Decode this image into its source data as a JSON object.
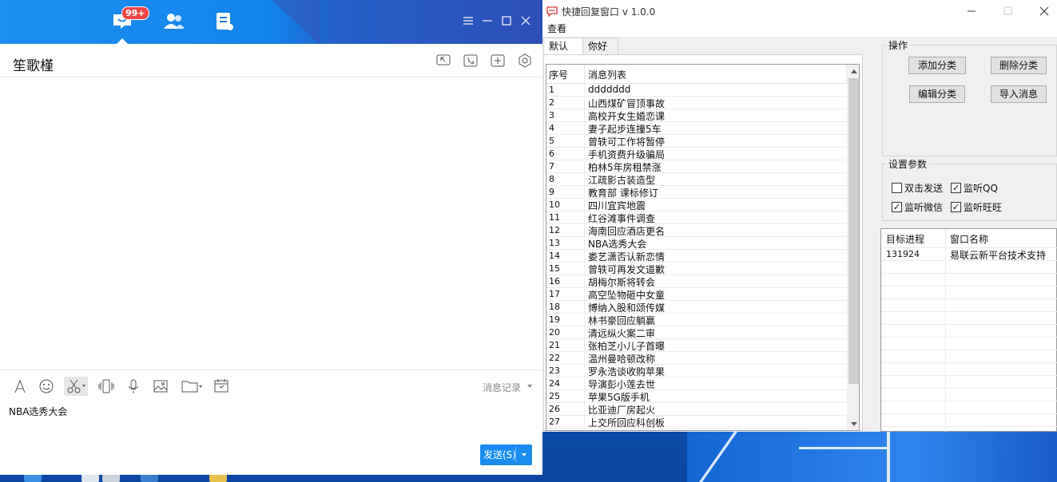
{
  "qq": {
    "badge": "99+",
    "contact_name": "笙歌槿",
    "history_label": "消息记录",
    "input_text": "NBA选秀大会",
    "send_label": "发送(S)"
  },
  "quick_reply": {
    "title": "快捷回复窗口 v 1.0.0",
    "menu_view": "查看",
    "tabs": [
      "默认",
      "你好"
    ],
    "list_headers": [
      "序号",
      "消息列表"
    ],
    "rows": [
      [
        "1",
        "ddddddd"
      ],
      [
        "2",
        "山西煤矿冒顶事故"
      ],
      [
        "3",
        "高校开女生婚恋课"
      ],
      [
        "4",
        "妻子起步连撞5车"
      ],
      [
        "5",
        "曾轶可工作将暂停"
      ],
      [
        "6",
        "手机资费升级骗局"
      ],
      [
        "7",
        "柏林5年房租禁涨"
      ],
      [
        "8",
        "江疏影古装造型"
      ],
      [
        "9",
        "教育部 课标修订"
      ],
      [
        "10",
        "四川宜宾地震"
      ],
      [
        "11",
        "红谷滩事件调查"
      ],
      [
        "12",
        "海南回应酒店更名"
      ],
      [
        "13",
        "NBA选秀大会"
      ],
      [
        "14",
        "娄艺潇否认新恋情"
      ],
      [
        "15",
        "曾轶可再发文道歉"
      ],
      [
        "16",
        "胡梅尔斯将转会"
      ],
      [
        "17",
        "高空坠物砸中女童"
      ],
      [
        "18",
        "博纳入股和颂传媒"
      ],
      [
        "19",
        "林书豪回应躺赢"
      ],
      [
        "20",
        "清远纵火案二审"
      ],
      [
        "21",
        "张柏芝小儿子首曝"
      ],
      [
        "22",
        "温州曼哈顿改称"
      ],
      [
        "23",
        "罗永浩谈收购苹果"
      ],
      [
        "24",
        "导演彭小莲去世"
      ],
      [
        "25",
        "苹果5G版手机"
      ],
      [
        "26",
        "比亚迪厂房起火"
      ],
      [
        "27",
        "上交所回应科创板"
      ]
    ],
    "ops_title": "操作",
    "btn_add": "添加分类",
    "btn_delete": "删除分类",
    "btn_edit": "编辑分类",
    "btn_import": "导入消息",
    "settings_title": "设置参数",
    "chk_double_click": "双击发送",
    "chk_listen_qq": "监听QQ",
    "chk_listen_wechat": "监听微信",
    "chk_listen_wangwang": "监听旺旺",
    "proc_headers": [
      "目标进程",
      "窗口名称"
    ],
    "proc_rows": [
      [
        "131924",
        "易联云新平台技术支持"
      ]
    ]
  }
}
